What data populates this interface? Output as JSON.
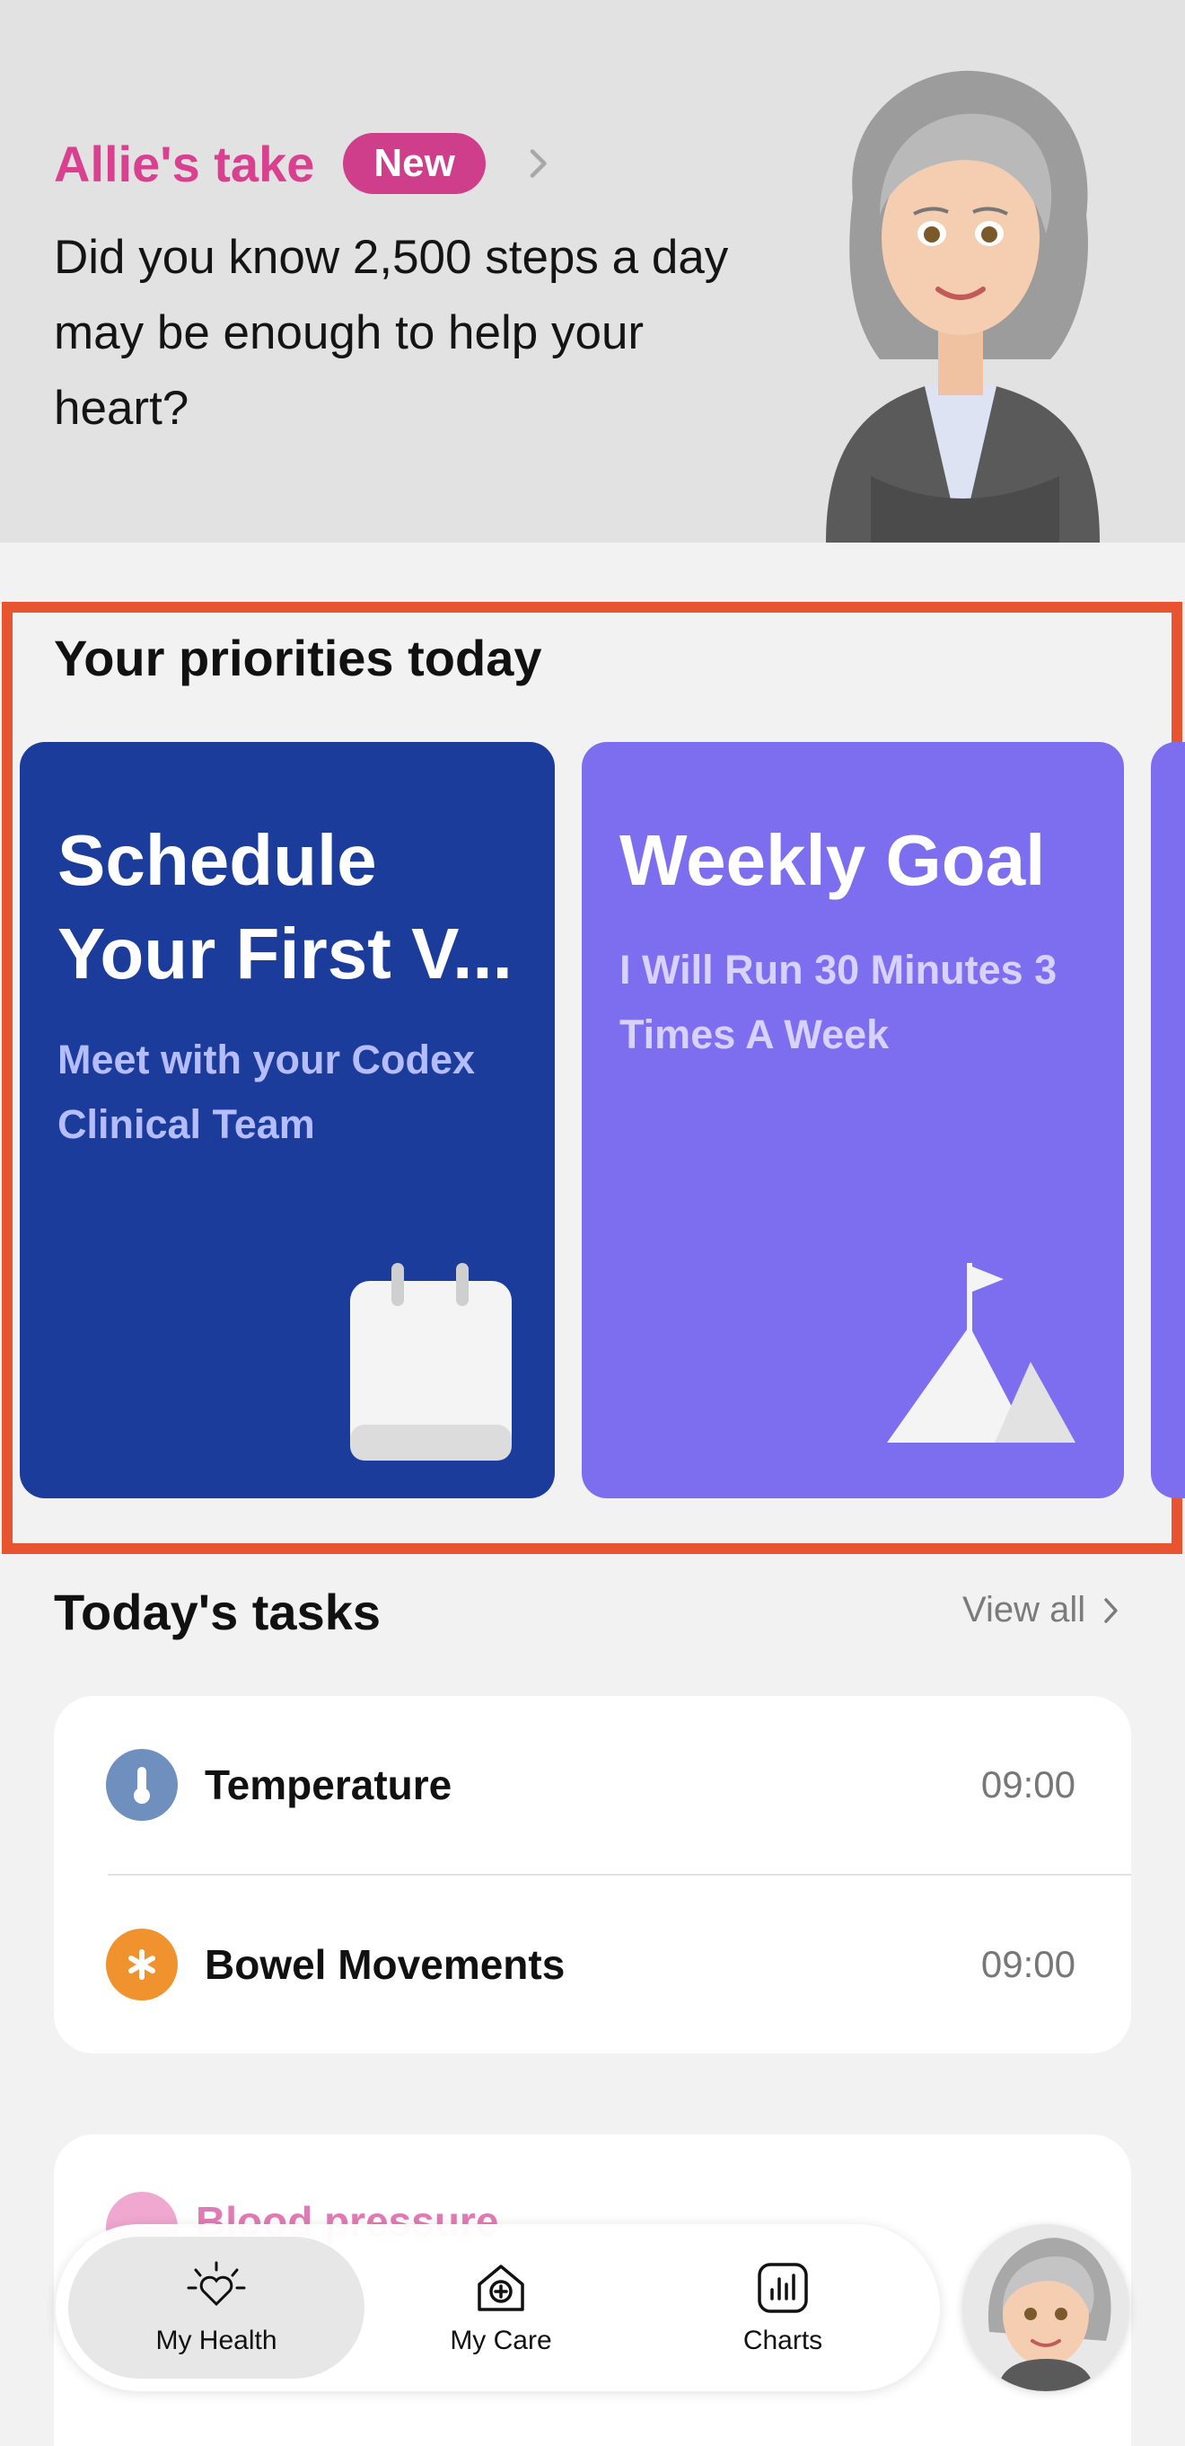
{
  "hero": {
    "title": "Allie's take",
    "badge": "New",
    "body": "Did you know 2,500 steps a day may be enough to help your heart?"
  },
  "priorities": {
    "title": "Your priorities today",
    "cards": [
      {
        "title": "Schedule Your First V...",
        "subtitle": "Meet with your Codex Clinical Team",
        "icon": "calendar-icon",
        "color": "#1c3c9c"
      },
      {
        "title": "Weekly Goal",
        "subtitle": "I Will Run 30 Minutes 3 Times A Week",
        "icon": "mountain-flag-icon",
        "color": "#7d6eef"
      }
    ]
  },
  "tasks": {
    "title": "Today's tasks",
    "view_all": "View all",
    "items": [
      {
        "label": "Temperature",
        "time": "09:00",
        "icon": "thermometer-icon",
        "color": "#6f8fbf"
      },
      {
        "label": "Bowel Movements",
        "time": "09:00",
        "icon": "asterisk-icon",
        "color": "#f0932f"
      }
    ]
  },
  "vitals": {
    "label": "Blood pressure"
  },
  "nav": {
    "items": [
      {
        "label": "My Health",
        "icon": "heart-sun-icon",
        "active": true
      },
      {
        "label": "My Care",
        "icon": "house-plus-icon",
        "active": false
      },
      {
        "label": "Charts",
        "icon": "bar-chart-icon",
        "active": false
      }
    ]
  }
}
